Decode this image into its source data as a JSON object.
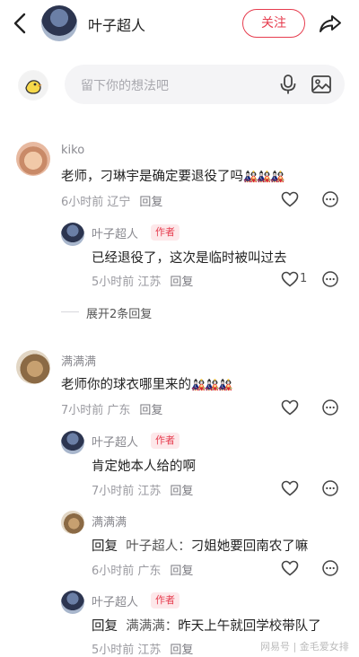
{
  "header": {
    "name": "叶子超人",
    "follow_label": "关注"
  },
  "input": {
    "placeholder": "留下你的想法吧"
  },
  "comments": [
    {
      "user": "kiko",
      "text": "老师，刁琳宇是确定要退役了吗",
      "emojis": "🎎🎎🎎",
      "time": "6小时前 辽宁",
      "reply": "回复",
      "replies": [
        {
          "user": "叶子超人",
          "tag": "作者",
          "text": "已经退役了，这次是临时被叫过去",
          "time": "5小时前 江苏",
          "reply": "回复",
          "likes": "1"
        }
      ],
      "expand": "展开2条回复"
    },
    {
      "user": "满满满",
      "text": "老师你的球衣哪里来的",
      "emojis": "🎎🎎🎎",
      "time": "7小时前 广东",
      "reply": "回复",
      "replies": [
        {
          "user": "叶子超人",
          "tag": "作者",
          "text": "肯定她本人给的啊",
          "time": "7小时前 江苏",
          "reply": "回复"
        },
        {
          "user": "满满满",
          "prefix": "回复",
          "mention": "叶子超人：",
          "text": "刁姐她要回南农了嘛",
          "time": "6小时前 广东",
          "reply": "回复"
        },
        {
          "user": "叶子超人",
          "tag": "作者",
          "prefix": "回复",
          "mention": "满满满：",
          "text": "昨天上午就回学校带队了",
          "time": "5小时前 江苏",
          "reply": "回复"
        }
      ]
    }
  ],
  "watermark": "网易号 | 金毛爱女排"
}
